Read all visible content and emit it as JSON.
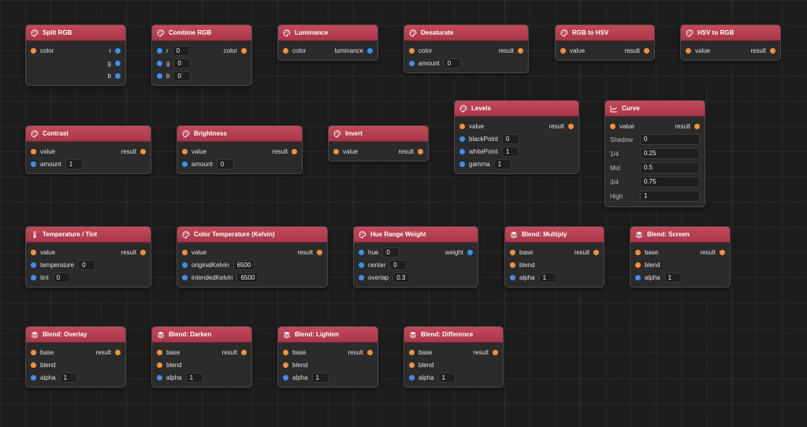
{
  "nodes": {
    "split_rgb": {
      "title": "Split RGB",
      "in_color": "color",
      "out_r": "r",
      "out_g": "g",
      "out_b": "b"
    },
    "combine_rgb": {
      "title": "Combine RGB",
      "in_r": "r",
      "r_val": "0",
      "in_g": "g",
      "g_val": "0",
      "in_b": "b",
      "b_val": "0",
      "out_color": "color"
    },
    "luminance": {
      "title": "Luminance",
      "in_color": "color",
      "out_luminance": "luminance"
    },
    "desaturate": {
      "title": "Desaturate",
      "in_color": "color",
      "out_result": "result",
      "in_amount": "amount",
      "amount_val": "0"
    },
    "rgb_to_hsv": {
      "title": "RGB to HSV",
      "in_value": "value",
      "out_result": "result"
    },
    "hsv_to_rgb": {
      "title": "HSV to RGB",
      "in_value": "value",
      "out_result": "result"
    },
    "levels": {
      "title": "Levels",
      "in_value": "value",
      "out_result": "result",
      "in_black": "blackPoint",
      "black_val": "0",
      "in_white": "whitePoint",
      "white_val": "1",
      "in_gamma": "gamma",
      "gamma_val": "1"
    },
    "curve": {
      "title": "Curve",
      "in_value": "value",
      "out_result": "result",
      "points": [
        {
          "label": "Shadow",
          "value": "0"
        },
        {
          "label": "1/4",
          "value": "0.25"
        },
        {
          "label": "Mid",
          "value": "0.5"
        },
        {
          "label": "3/4",
          "value": "0.75"
        },
        {
          "label": "High",
          "value": "1"
        }
      ]
    },
    "contrast": {
      "title": "Contrast",
      "in_value": "value",
      "out_result": "result",
      "in_amount": "amount",
      "amount_val": "1"
    },
    "brightness": {
      "title": "Brightness",
      "in_value": "value",
      "out_result": "result",
      "in_amount": "amount",
      "amount_val": "0"
    },
    "invert": {
      "title": "Invert",
      "in_value": "value",
      "out_result": "result"
    },
    "temperature_tint": {
      "title": "Temperature / Tint",
      "in_value": "value",
      "out_result": "result",
      "in_temperature": "temperature",
      "temperature_val": "0",
      "in_tint": "tint",
      "tint_val": "0"
    },
    "color_temperature": {
      "title": "Color Temperature (Kelvin)",
      "in_value": "value",
      "out_result": "result",
      "in_original": "originalKelvin",
      "original_val": "6500",
      "in_intended": "intendedKelvin",
      "intended_val": "6500"
    },
    "hue_range": {
      "title": "Hue Range Weight",
      "in_hue": "hue",
      "hue_val": "0",
      "out_weight": "weight",
      "in_center": "center",
      "center_val": "0",
      "in_overlap": "overlap",
      "overlap_val": "0.3"
    },
    "blend_multiply": {
      "title": "Blend: Multiply",
      "in_base": "base",
      "out_result": "result",
      "in_blend": "blend",
      "in_alpha": "alpha",
      "alpha_val": "1"
    },
    "blend_screen": {
      "title": "Blend: Screen",
      "in_base": "base",
      "out_result": "result",
      "in_blend": "blend",
      "in_alpha": "alpha",
      "alpha_val": "1"
    },
    "blend_overlay": {
      "title": "Blend: Overlay",
      "in_base": "base",
      "out_result": "result",
      "in_blend": "blend",
      "in_alpha": "alpha",
      "alpha_val": "1"
    },
    "blend_darken": {
      "title": "Blend: Darken",
      "in_base": "base",
      "out_result": "result",
      "in_blend": "blend",
      "in_alpha": "alpha",
      "alpha_val": "1"
    },
    "blend_lighten": {
      "title": "Blend: Lighten",
      "in_base": "base",
      "out_result": "result",
      "in_blend": "blend",
      "in_alpha": "alpha",
      "alpha_val": "1"
    },
    "blend_difference": {
      "title": "Blend: Difference",
      "in_base": "base",
      "out_result": "result",
      "in_blend": "blend",
      "in_alpha": "alpha",
      "alpha_val": "1"
    }
  },
  "colors": {
    "header": "#b8404f",
    "port_color": "#f0923b",
    "port_number": "#3f8ef0",
    "canvas": "#1d1d1d"
  }
}
